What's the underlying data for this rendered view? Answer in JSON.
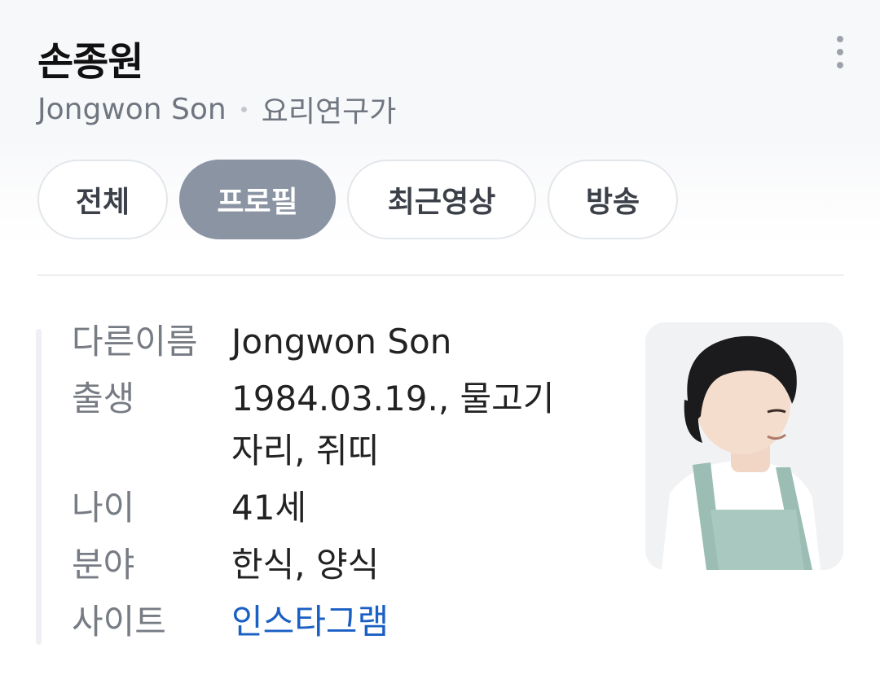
{
  "header": {
    "title": "손종원",
    "subtitle_name": "Jongwon Son",
    "subtitle_role": "요리연구가"
  },
  "tabs": [
    {
      "label": "전체",
      "active": false
    },
    {
      "label": "프로필",
      "active": true
    },
    {
      "label": "최근영상",
      "active": false
    },
    {
      "label": "방송",
      "active": false
    }
  ],
  "profile": {
    "rows": [
      {
        "label": "다른이름",
        "value": "Jongwon Son"
      },
      {
        "label": "출생",
        "value": "1984.03.19., 물고기자리, 쥐띠"
      },
      {
        "label": "나이",
        "value": "41세"
      },
      {
        "label": "분야",
        "value": "한식, 양식"
      },
      {
        "label": "사이트",
        "value": "인스타그램"
      }
    ]
  },
  "icons": {
    "more": "more-vertical-icon"
  },
  "colors": {
    "active_tab": "#8a94a3",
    "link": "#1a5fc4",
    "label": "#777c84"
  }
}
